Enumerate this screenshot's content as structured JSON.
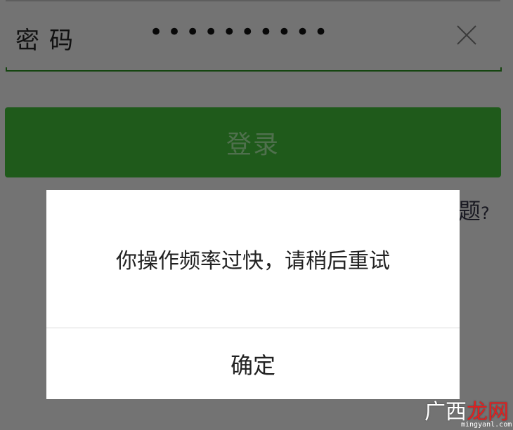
{
  "login_form": {
    "password_label": "密码",
    "password_value": "••••••••••",
    "login_button_label": "登录",
    "problem_link_partial": "题",
    "problem_link_suffix": "?"
  },
  "dialog": {
    "message": "你操作频率过快，请稍后重试",
    "confirm_label": "确定"
  },
  "watermark": {
    "text_a": "广西",
    "text_b": "龙网",
    "url": "mingyanl.com"
  },
  "colors": {
    "primary_green": "#3fb536",
    "overlay": "rgba(0,0,0,0.5)"
  },
  "icons": {
    "clear": "close-icon"
  }
}
